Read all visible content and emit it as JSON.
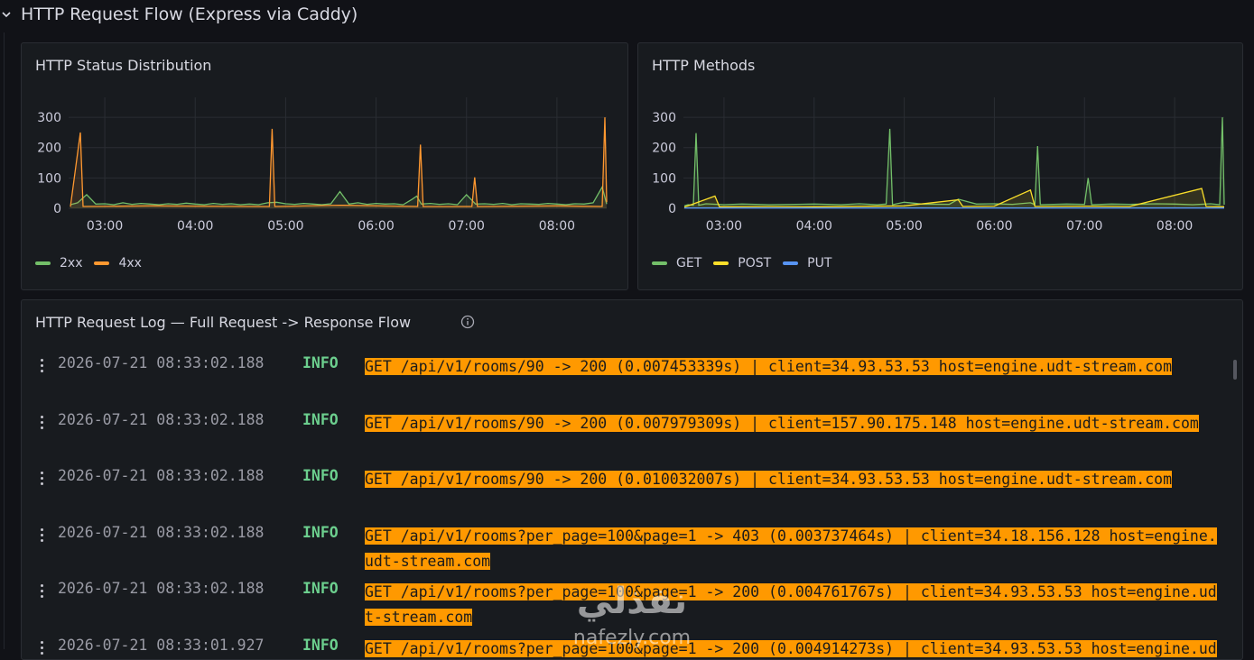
{
  "row": {
    "title": "HTTP Request Flow (Express via Caddy)"
  },
  "status_panel": {
    "title": "HTTP Status Distribution",
    "legend": [
      {
        "label": "2xx",
        "color": "#73bf69"
      },
      {
        "label": "4xx",
        "color": "#ff9830"
      }
    ]
  },
  "methods_panel": {
    "title": "HTTP Methods",
    "legend": [
      {
        "label": "GET",
        "color": "#73bf69"
      },
      {
        "label": "POST",
        "color": "#fade2a"
      },
      {
        "label": "PUT",
        "color": "#5794f2"
      }
    ]
  },
  "log_panel": {
    "title": "HTTP Request Log — Full Request -> Response Flow",
    "info_icon": "info-circle-icon",
    "rows": [
      {
        "ts": "2026-07-21 08:33:02.188",
        "level": "INFO",
        "msg": "GET /api/v1/rooms/90 -> 200 (0.007453339s) | client=34.93.53.53 host=engine.udt-stream.com"
      },
      {
        "ts": "2026-07-21 08:33:02.188",
        "level": "INFO",
        "msg": "GET /api/v1/rooms/90 -> 200 (0.007979309s) | client=157.90.175.148 host=engine.udt-stream.com"
      },
      {
        "ts": "2026-07-21 08:33:02.188",
        "level": "INFO",
        "msg": "GET /api/v1/rooms/90 -> 200 (0.010032007s) | client=34.93.53.53 host=engine.udt-stream.com"
      },
      {
        "ts": "2026-07-21 08:33:02.188",
        "level": "INFO",
        "msg": "GET /api/v1/rooms?per_page=100&page=1 -> 403 (0.003737464s) | client=34.18.156.128 host=engine.udt-stream.com"
      },
      {
        "ts": "2026-07-21 08:33:02.188",
        "level": "INFO",
        "msg": "GET /api/v1/rooms?per_page=100&page=1 -> 200 (0.004761767s) | client=34.93.53.53 host=engine.udt-stream.com"
      },
      {
        "ts": "2026-07-21 08:33:01.927",
        "level": "INFO",
        "msg": "GET /api/v1/rooms?per_page=100&page=1 -> 200 (0.004914273s) | client=34.93.53.53 host=engine.udt-stream.com"
      }
    ]
  },
  "watermark": {
    "arabic": "نفذلي",
    "latin": "nafezly.com"
  },
  "chart_data": [
    {
      "type": "line",
      "title": "HTTP Status Distribution",
      "x_ticks": [
        "03:00",
        "04:00",
        "05:00",
        "06:00",
        "07:00",
        "08:00"
      ],
      "y_ticks": [
        0,
        100,
        200,
        300
      ],
      "ylim": [
        0,
        330
      ],
      "x_range_hours": [
        2.6,
        8.55
      ],
      "grid": true,
      "legend_position": "bottom-left",
      "series": [
        {
          "name": "2xx",
          "color": "#73bf69",
          "points": [
            [
              2.62,
              12
            ],
            [
              2.7,
              18
            ],
            [
              2.8,
              45
            ],
            [
              2.9,
              14
            ],
            [
              3.0,
              15
            ],
            [
              3.1,
              12
            ],
            [
              3.2,
              18
            ],
            [
              3.3,
              13
            ],
            [
              3.4,
              16
            ],
            [
              3.5,
              14
            ],
            [
              3.6,
              12
            ],
            [
              3.7,
              15
            ],
            [
              3.8,
              13
            ],
            [
              3.9,
              17
            ],
            [
              4.0,
              14
            ],
            [
              4.1,
              12
            ],
            [
              4.2,
              16
            ],
            [
              4.3,
              13
            ],
            [
              4.4,
              15
            ],
            [
              4.5,
              12
            ],
            [
              4.6,
              14
            ],
            [
              4.7,
              12
            ],
            [
              4.8,
              18
            ],
            [
              4.9,
              20
            ],
            [
              5.0,
              15
            ],
            [
              5.1,
              13
            ],
            [
              5.2,
              16
            ],
            [
              5.3,
              14
            ],
            [
              5.4,
              12
            ],
            [
              5.5,
              15
            ],
            [
              5.6,
              55
            ],
            [
              5.7,
              14
            ],
            [
              5.8,
              18
            ],
            [
              5.9,
              13
            ],
            [
              6.0,
              16
            ],
            [
              6.1,
              14
            ],
            [
              6.2,
              15
            ],
            [
              6.3,
              12
            ],
            [
              6.4,
              30
            ],
            [
              6.45,
              40
            ],
            [
              6.5,
              14
            ],
            [
              6.6,
              16
            ],
            [
              6.7,
              13
            ],
            [
              6.8,
              15
            ],
            [
              6.9,
              12
            ],
            [
              7.0,
              45
            ],
            [
              7.1,
              14
            ],
            [
              7.2,
              15
            ],
            [
              7.3,
              13
            ],
            [
              7.4,
              16
            ],
            [
              7.5,
              12
            ],
            [
              7.6,
              15
            ],
            [
              7.7,
              14
            ],
            [
              7.8,
              13
            ],
            [
              7.9,
              16
            ],
            [
              8.0,
              14
            ],
            [
              8.1,
              12
            ],
            [
              8.2,
              15
            ],
            [
              8.3,
              14
            ],
            [
              8.4,
              18
            ],
            [
              8.5,
              70
            ],
            [
              8.55,
              14
            ]
          ]
        },
        {
          "name": "4xx",
          "color": "#ff9830",
          "points": [
            [
              2.62,
              5
            ],
            [
              2.73,
              250
            ],
            [
              2.76,
              6
            ],
            [
              3.5,
              8
            ],
            [
              4.82,
              6
            ],
            [
              4.85,
              262
            ],
            [
              4.88,
              6
            ],
            [
              5.6,
              10
            ],
            [
              6.46,
              6
            ],
            [
              6.49,
              210
            ],
            [
              6.52,
              6
            ],
            [
              7.06,
              6
            ],
            [
              7.09,
              102
            ],
            [
              7.12,
              6
            ],
            [
              8.0,
              8
            ],
            [
              8.5,
              6
            ],
            [
              8.53,
              300
            ],
            [
              8.55,
              20
            ]
          ]
        }
      ]
    },
    {
      "type": "line",
      "title": "HTTP Methods",
      "x_ticks": [
        "03:00",
        "04:00",
        "05:00",
        "06:00",
        "07:00",
        "08:00"
      ],
      "y_ticks": [
        0,
        100,
        200,
        300
      ],
      "ylim": [
        0,
        330
      ],
      "x_range_hours": [
        2.55,
        8.55
      ],
      "grid": true,
      "legend_position": "bottom-left",
      "series": [
        {
          "name": "GET",
          "color": "#73bf69",
          "points": [
            [
              2.56,
              8
            ],
            [
              2.6,
              12
            ],
            [
              2.66,
              10
            ],
            [
              2.69,
              248
            ],
            [
              2.72,
              10
            ],
            [
              2.8,
              15
            ],
            [
              3.0,
              12
            ],
            [
              3.2,
              14
            ],
            [
              3.5,
              12
            ],
            [
              3.8,
              13
            ],
            [
              4.0,
              14
            ],
            [
              4.3,
              12
            ],
            [
              4.5,
              15
            ],
            [
              4.7,
              12
            ],
            [
              4.8,
              14
            ],
            [
              4.84,
              262
            ],
            [
              4.87,
              12
            ],
            [
              5.0,
              20
            ],
            [
              5.2,
              14
            ],
            [
              5.5,
              13
            ],
            [
              5.6,
              30
            ],
            [
              5.8,
              14
            ],
            [
              6.0,
              15
            ],
            [
              6.2,
              13
            ],
            [
              6.4,
              18
            ],
            [
              6.45,
              12
            ],
            [
              6.48,
              205
            ],
            [
              6.51,
              12
            ],
            [
              6.8,
              14
            ],
            [
              7.0,
              13
            ],
            [
              7.04,
              100
            ],
            [
              7.08,
              12
            ],
            [
              7.3,
              14
            ],
            [
              7.5,
              13
            ],
            [
              7.8,
              15
            ],
            [
              8.0,
              14
            ],
            [
              8.2,
              12
            ],
            [
              8.4,
              15
            ],
            [
              8.5,
              12
            ],
            [
              8.53,
              300
            ],
            [
              8.55,
              12
            ]
          ]
        },
        {
          "name": "POST",
          "color": "#fade2a",
          "points": [
            [
              2.56,
              4
            ],
            [
              2.9,
              40
            ],
            [
              2.95,
              5
            ],
            [
              3.5,
              6
            ],
            [
              4.0,
              5
            ],
            [
              5.0,
              8
            ],
            [
              5.6,
              28
            ],
            [
              5.65,
              6
            ],
            [
              6.0,
              7
            ],
            [
              6.4,
              60
            ],
            [
              6.45,
              6
            ],
            [
              7.0,
              7
            ],
            [
              7.5,
              6
            ],
            [
              8.3,
              65
            ],
            [
              8.35,
              6
            ],
            [
              8.55,
              5
            ]
          ]
        },
        {
          "name": "PUT",
          "color": "#5794f2",
          "points": [
            [
              2.56,
              1
            ],
            [
              4.0,
              1
            ],
            [
              6.0,
              1
            ],
            [
              8.55,
              1
            ]
          ]
        }
      ]
    }
  ]
}
